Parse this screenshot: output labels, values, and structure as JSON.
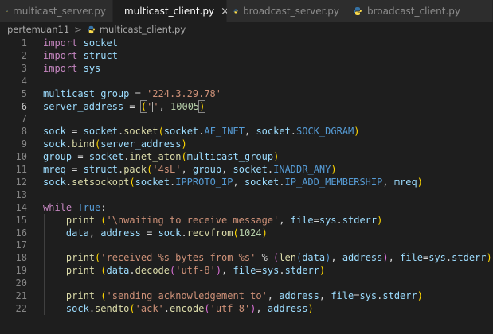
{
  "tabs": [
    {
      "label": "multicast_server.py",
      "active": false
    },
    {
      "label": "multicast_client.py",
      "active": true
    },
    {
      "label": "broadcast_server.py",
      "active": false
    },
    {
      "label": "broadcast_client.py",
      "active": false
    }
  ],
  "close_glyph": "×",
  "breadcrumb": {
    "folder": "pertemuan11",
    "separator": ">",
    "file": "multicast_client.py"
  },
  "colors": {
    "python_icon_blue": "#3572a5",
    "python_icon_yellow": "#f7d84b"
  },
  "icons": {
    "tab_file": "python-file-icon"
  },
  "editor": {
    "current_line": 6,
    "lines": [
      {
        "n": "1",
        "text": "import socket"
      },
      {
        "n": "2",
        "text": "import struct"
      },
      {
        "n": "3",
        "text": "import sys"
      },
      {
        "n": "4",
        "text": ""
      },
      {
        "n": "5",
        "text": "multicast_group = '224.3.29.78'"
      },
      {
        "n": "6",
        "text": "server_address = ('', 10005)"
      },
      {
        "n": "7",
        "text": ""
      },
      {
        "n": "8",
        "text": "sock = socket.socket(socket.AF_INET, socket.SOCK_DGRAM)"
      },
      {
        "n": "9",
        "text": "sock.bind(server_address)"
      },
      {
        "n": "10",
        "text": "group = socket.inet_aton(multicast_group)"
      },
      {
        "n": "11",
        "text": "mreq = struct.pack('4sL', group, socket.INADDR_ANY)"
      },
      {
        "n": "12",
        "text": "sock.setsockopt(socket.IPPROTO_IP, socket.IP_ADD_MEMBERSHIP, mreq)"
      },
      {
        "n": "13",
        "text": ""
      },
      {
        "n": "14",
        "text": "while True:"
      },
      {
        "n": "15",
        "text": "    print ('\\nwaiting to receive message', file=sys.stderr)"
      },
      {
        "n": "16",
        "text": "    data, address = sock.recvfrom(1024)"
      },
      {
        "n": "17",
        "text": ""
      },
      {
        "n": "18",
        "text": "    print('received %s bytes from %s' % (len(data), address), file=sys.stderr)"
      },
      {
        "n": "19",
        "text": "    print (data.decode('utf-8'), file=sys.stderr)"
      },
      {
        "n": "20",
        "text": ""
      },
      {
        "n": "21",
        "text": "    print ('sending acknowledgement to', address, file=sys.stderr)"
      },
      {
        "n": "22",
        "text": "    sock.sendto('ack'.encode('utf-8'), address)"
      }
    ]
  }
}
